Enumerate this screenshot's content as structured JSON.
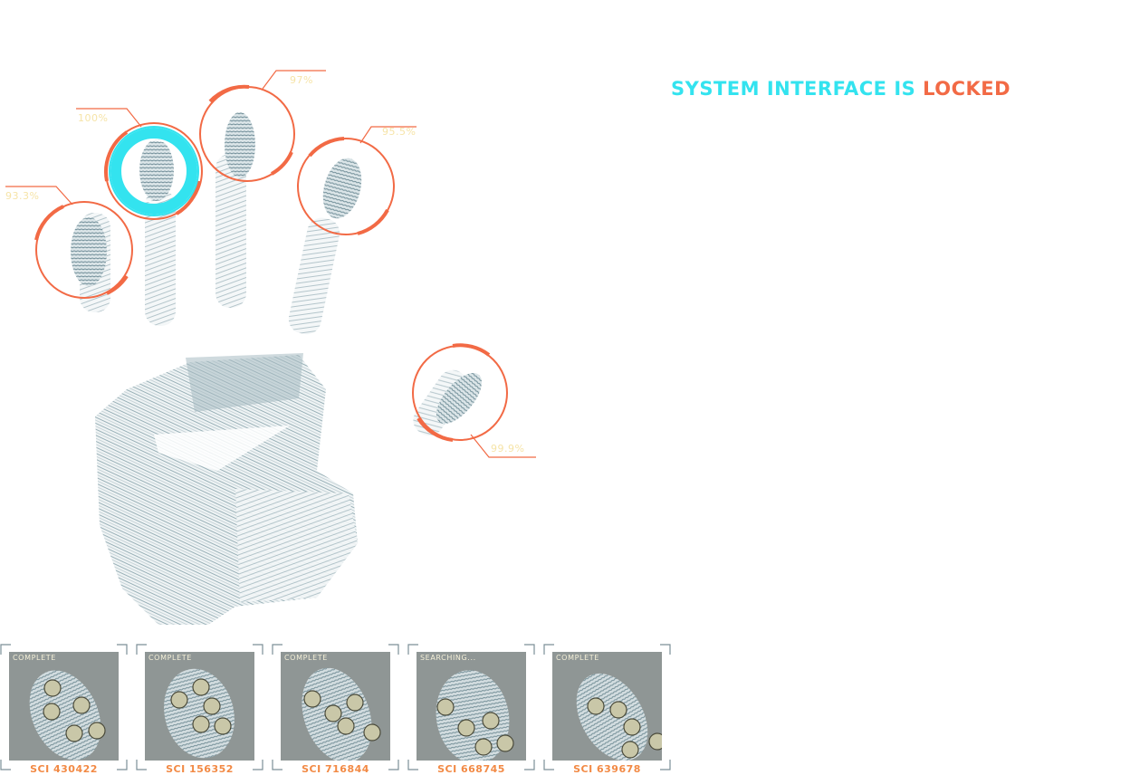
{
  "header": {
    "title_part1": "SYSTEM INTERFACE IS",
    "title_part2": "LOCKED"
  },
  "colors": {
    "accent_cyan": "#33e3ef",
    "accent_orange": "#f26a45",
    "label_cream": "#f6e4a8"
  },
  "finger_scans": [
    {
      "label": "93.3%"
    },
    {
      "label": "100%"
    },
    {
      "label": "97%"
    },
    {
      "label": "95.5%"
    },
    {
      "label": "99.9%"
    }
  ],
  "samples": [
    {
      "status": "COMPLETE",
      "code": "SCI 430422"
    },
    {
      "status": "COMPLETE",
      "code": "SCI 156352"
    },
    {
      "status": "COMPLETE",
      "code": "SCI 716844"
    },
    {
      "status": "SEARCHING...",
      "code": "SCI 668745"
    },
    {
      "status": "COMPLETE",
      "code": "SCI 639678"
    }
  ]
}
